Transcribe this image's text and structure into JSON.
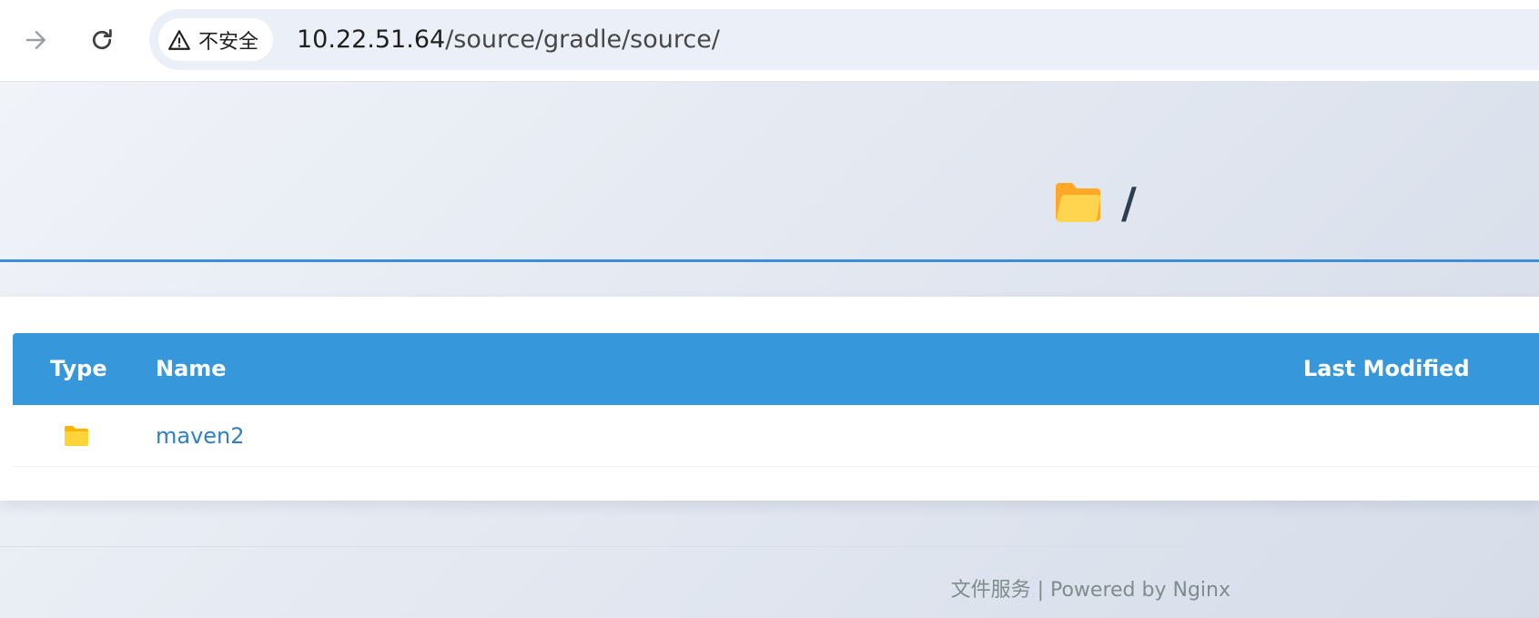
{
  "browser": {
    "security_label": "不安全",
    "url_host": "10.22.51.64",
    "url_path": "/source/gradle/source/"
  },
  "header": {
    "title": "/",
    "icon": "folder-open-icon"
  },
  "listing": {
    "columns": {
      "type": "Type",
      "name": "Name",
      "last_modified": "Last Modified"
    },
    "rows": [
      {
        "type": "folder-icon",
        "name": "maven2",
        "last_modified": ""
      }
    ]
  },
  "footer": {
    "text": "文件服务 | Powered by Nginx"
  },
  "colors": {
    "accent": "#3698db",
    "folder": "#ffd43b",
    "link": "#2f80c4"
  }
}
